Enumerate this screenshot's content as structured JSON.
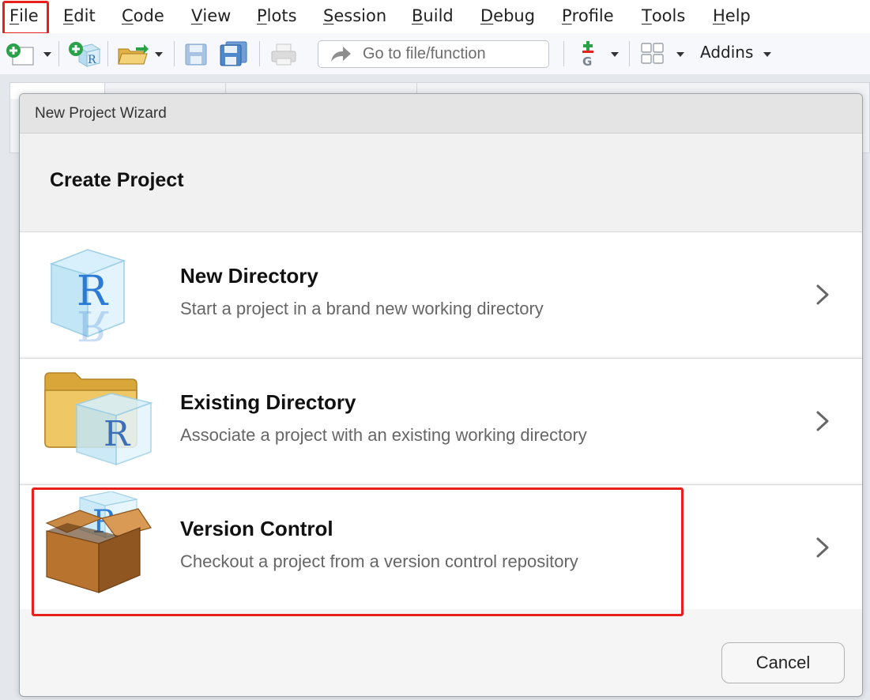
{
  "menubar": {
    "items": [
      {
        "mnemonic": "F",
        "rest": "ile"
      },
      {
        "mnemonic": "E",
        "rest": "dit"
      },
      {
        "mnemonic": "C",
        "rest": "ode"
      },
      {
        "mnemonic": "V",
        "rest": "iew"
      },
      {
        "mnemonic": "P",
        "rest": "lots"
      },
      {
        "mnemonic": "S",
        "rest": "ession"
      },
      {
        "mnemonic": "B",
        "rest": "uild"
      },
      {
        "mnemonic": "D",
        "rest": "ebug"
      },
      {
        "mnemonic": "P",
        "rest": "rofile"
      },
      {
        "mnemonic": "T",
        "rest": "ools"
      },
      {
        "mnemonic": "H",
        "rest": "elp"
      }
    ]
  },
  "toolbar": {
    "goto_placeholder": "Go to file/function",
    "addins_label": "Addins",
    "icons": [
      "new-file-icon",
      "new-project-icon",
      "open-folder-icon",
      "save-icon",
      "save-all-icon",
      "print-icon",
      "arrow-icon",
      "git-icon",
      "layout-grid-icon"
    ]
  },
  "dialog": {
    "title": "New Project Wizard",
    "heading": "Create Project",
    "options": [
      {
        "title": "New Directory",
        "description": "Start a project in a brand new working directory",
        "icon": "r-cube-icon"
      },
      {
        "title": "Existing Directory",
        "description": "Associate a project with an existing working directory",
        "icon": "folder-r-cube-icon"
      },
      {
        "title": "Version Control",
        "description": "Checkout a project from a version control repository",
        "icon": "box-icon"
      }
    ],
    "cancel_label": "Cancel"
  },
  "colors": {
    "highlight": "#e8201c",
    "r_blue": "#2b7bd6",
    "folder_yellow": "#e6b94a",
    "box_brown": "#b8742f"
  }
}
